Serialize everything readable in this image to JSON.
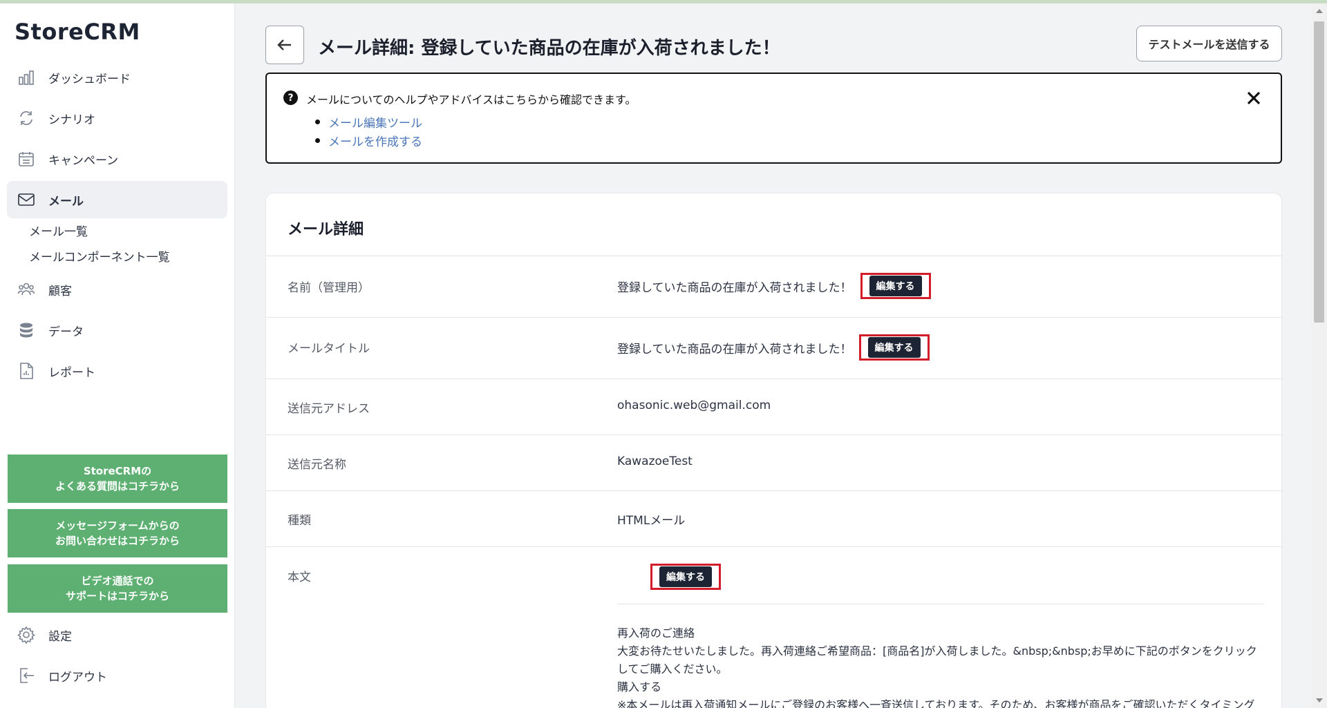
{
  "app": {
    "logo": "StoreCRM"
  },
  "sidebar": {
    "items": [
      {
        "label": "ダッシュボード",
        "icon": "bar-chart-icon"
      },
      {
        "label": "シナリオ",
        "icon": "cycle-icon"
      },
      {
        "label": "キャンペーン",
        "icon": "calendar-icon"
      },
      {
        "label": "メール",
        "icon": "mail-icon",
        "active": true
      },
      {
        "label": "顧客",
        "icon": "people-icon"
      },
      {
        "label": "データ",
        "icon": "database-icon"
      },
      {
        "label": "レポート",
        "icon": "report-icon"
      }
    ],
    "sub_items": [
      "メール一覧",
      "メールコンポーネント一覧"
    ],
    "support_buttons": [
      {
        "line1": "StoreCRMの",
        "line2": "よくある質問はコチラから"
      },
      {
        "line1": "メッセージフォームからの",
        "line2": "お問い合わせはコチラから"
      },
      {
        "line1": "ビデオ通話での",
        "line2": "サポートはコチラから"
      }
    ],
    "bottom_items": [
      {
        "label": "設定",
        "icon": "gear-icon"
      },
      {
        "label": "ログアウト",
        "icon": "logout-icon"
      }
    ]
  },
  "header": {
    "title": "メール詳細: 登録していた商品の在庫が入荷されました！",
    "test_button": "テストメールを送信する"
  },
  "help": {
    "text": "メールについてのヘルプやアドバイスはこちらから確認できます。",
    "links": [
      "メール編集ツール",
      "メールを作成する"
    ]
  },
  "detail": {
    "title": "メール詳細",
    "edit_label": "編集する",
    "rows": [
      {
        "label": "名前（管理用）",
        "value": "登録していた商品の在庫が入荷されました！"
      },
      {
        "label": "メールタイトル",
        "value": "登録していた商品の在庫が入荷されました！"
      },
      {
        "label": "送信元アドレス",
        "value": "ohasonic.web@gmail.com"
      },
      {
        "label": "送信元名称",
        "value": "KawazoeTest"
      },
      {
        "label": "種類",
        "value": "HTMLメール"
      },
      {
        "label": "本文",
        "value": ""
      }
    ],
    "body_lines": [
      "再入荷のご連絡",
      "大変お待たせいたしました。再入荷連絡ご希望商品：[商品名]が入荷しました。&nbsp;&nbsp;お早めに下記のボタンをクリックしてご購入ください。",
      "購入する",
      "※本メールは再入荷通知メールにご登録のお客様へ一斉送信しております。そのため、お客様が商品をご確認いただくタイミング"
    ]
  }
}
